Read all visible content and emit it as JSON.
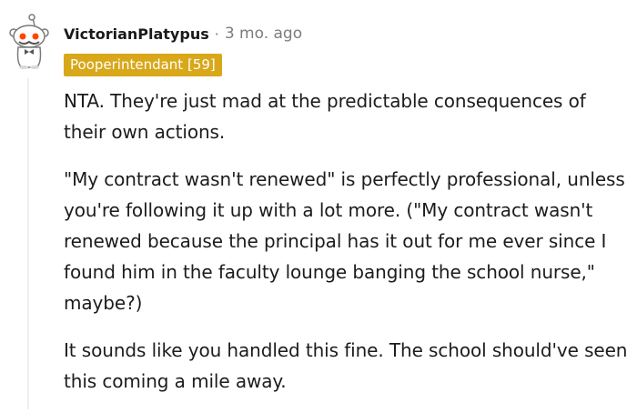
{
  "comment": {
    "username": "VictorianPlatypus",
    "separator": "·",
    "timestamp": "3 mo. ago",
    "flair": "Pooperintendant [59]",
    "flair_color": "#d8a81a",
    "avatar_icon": "snoo-avatar-icon",
    "paragraphs": [
      "NTA. They're just mad at the predictable consequences of their own actions.",
      "\"My contract wasn't renewed\" is perfectly professional, unless you're following it up with a lot more. (\"My contract wasn't renewed because the principal has it out for me ever since I found him in the faculty lounge banging the school nurse,\" maybe?)",
      "It sounds like you handled this fine. The school should've seen this coming a mile away."
    ]
  }
}
